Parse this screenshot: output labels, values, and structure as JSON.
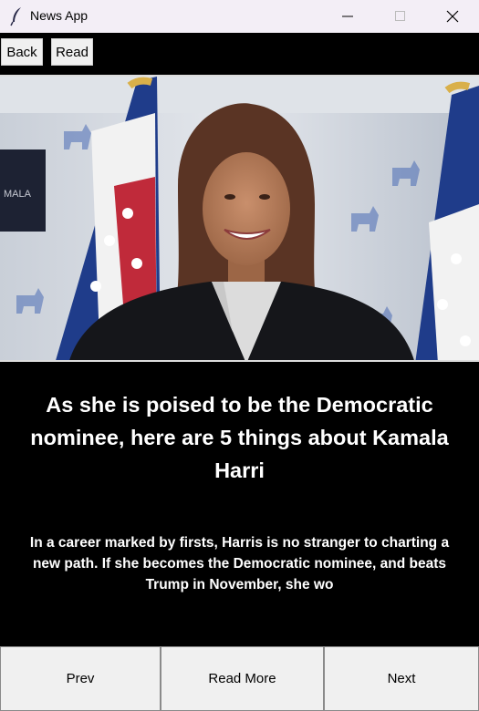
{
  "window": {
    "title": "News App",
    "controls": {
      "minimize": "minimize",
      "maximize": "maximize",
      "close": "close"
    }
  },
  "toolbar": {
    "back_label": "Back",
    "read_label": "Read"
  },
  "article": {
    "headline": "As she is poised to be the Democratic nominee, here are 5 things about Kamala Harri",
    "summary": "In a career marked by firsts, Harris is no stranger to charting a new path. If she becomes the Democratic nominee, and beats Trump in November, she wo"
  },
  "navigation": {
    "prev_label": "Prev",
    "read_more_label": "Read More",
    "next_label": "Next"
  },
  "colors": {
    "window_bg": "#000000",
    "titlebar_bg": "#f3eef6",
    "button_bg": "#f0f0f0",
    "text": "#ffffff"
  },
  "icons": {
    "app": "feather-icon"
  }
}
